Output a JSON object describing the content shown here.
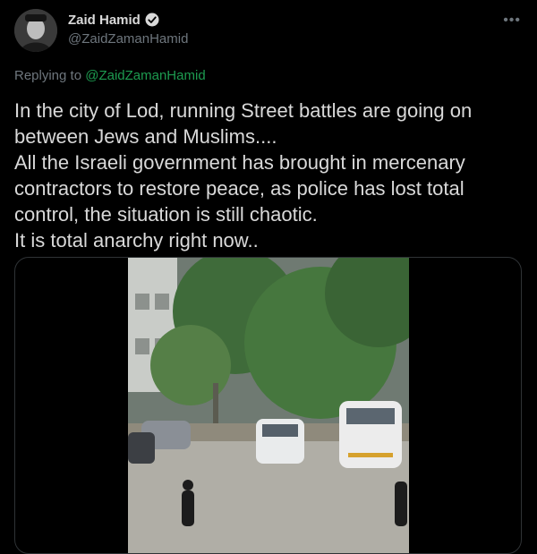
{
  "tweet": {
    "display_name": "Zaid Hamid",
    "handle": "@ZaidZamanHamid",
    "reply_prefix": "Replying to",
    "reply_to": "@ZaidZamanHamid",
    "text": "In the city of Lod, running Street battles are going on between Jews and Muslims....\nAll the Israeli government has brought in mercenary contractors to restore peace, as police has lost total control, the situation is still chaotic.\nIt is total anarchy right now..",
    "more_icon": "more-horizontal-icon",
    "verified_icon": "verified-badge-icon"
  },
  "colors": {
    "background": "#000000",
    "text": "#d9d9d9",
    "muted": "#6e767d",
    "mention": "#1d9b50",
    "border": "#2f3336"
  }
}
